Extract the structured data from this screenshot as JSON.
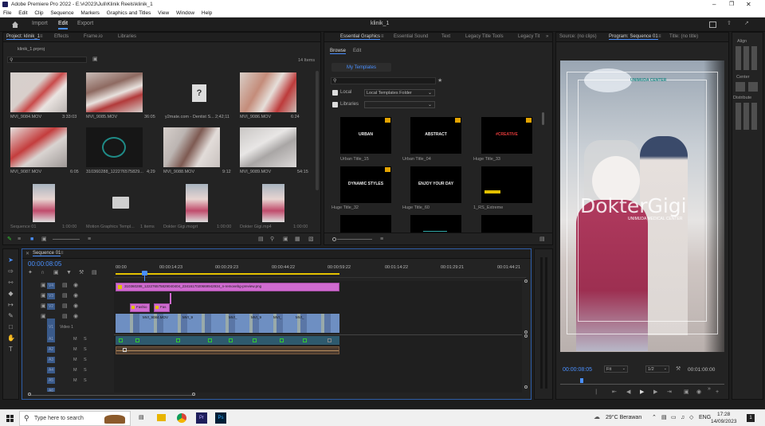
{
  "window": {
    "title": "Adobe Premiere Pro 2022 - E:\\#2023\\Juli\\Klinik Reels\\klinik_1"
  },
  "menu": [
    "File",
    "Edit",
    "Clip",
    "Sequence",
    "Markers",
    "Graphics and Titles",
    "View",
    "Window",
    "Help"
  ],
  "workspace": {
    "home": "home-icon",
    "tabs": [
      "Import",
      "Edit",
      "Export"
    ],
    "active": "Edit",
    "doc_title": "klinik_1"
  },
  "project": {
    "tabs": [
      "Project: klinik_1",
      "Effects",
      "Frame.io",
      "Libraries"
    ],
    "file": "klinik_1.prproj",
    "item_count": "14 Items",
    "items": [
      {
        "name": "MVI_9084.MOV",
        "dur": "3:33:03"
      },
      {
        "name": "MVI_9085.MOV",
        "dur": "36:05"
      },
      {
        "name": "y2mate.com - Dentist S...",
        "dur": "2;42;11"
      },
      {
        "name": "MVI_9086.MOV",
        "dur": "6:24"
      },
      {
        "name": "MVI_9087.MOV",
        "dur": "6:05"
      },
      {
        "name": "310360288_122276575829...",
        "dur": "4;29"
      },
      {
        "name": "MVI_9088.MOV",
        "dur": "9:12"
      },
      {
        "name": "MVI_9089.MOV",
        "dur": "54:15"
      },
      {
        "name": "Sequence 01",
        "dur": "1:00:00"
      },
      {
        "name": "Motion Graphics Templ...",
        "dur": "1 items"
      },
      {
        "name": "Dokter Gigi.mogrt",
        "dur": "1:00:00"
      },
      {
        "name": "Dokter Gigi.mp4",
        "dur": "1:00:00"
      }
    ]
  },
  "essential": {
    "tabs": [
      "Essential Graphics",
      "Essential Sound",
      "Text",
      "Legacy Title Tools",
      "Legacy Tit"
    ],
    "subtabs": [
      "Browse",
      "Edit"
    ],
    "my_templates": "My Templates",
    "local_label": "Local",
    "local_value": "Local Templates Folder",
    "libraries_label": "Libraries",
    "templates": [
      {
        "name": "Urban Title_15",
        "art": "URBAN"
      },
      {
        "name": "Urban Title_04",
        "art": "ABSTRACT"
      },
      {
        "name": "Huge Title_33",
        "art": "#CREATIVE"
      },
      {
        "name": "Huge Title_32",
        "art": "DYNAMIC STYLES"
      },
      {
        "name": "Huge Title_60",
        "art": "ENJOY YOUR DAY"
      },
      {
        "name": "1_RS_Extreme",
        "art": ""
      }
    ]
  },
  "monitor": {
    "tabs": [
      "Source: (no clips)",
      "Program: Sequence 01",
      "Title: (no title)"
    ],
    "timecode": "00:00:08:05",
    "fit": "Fit",
    "resolution": "1/2",
    "duration": "00:01:00:00",
    "overlay_title": "DokterGigi",
    "overlay_sub": "UNIMUDA MEDICAL CENTER",
    "logo": "UNIMUDA CENTER"
  },
  "align": {
    "title": "Align",
    "center": "Center",
    "distribute": "Distribute"
  },
  "timeline": {
    "tab": "Sequence 01",
    "timecode": "00:00:08:05",
    "ruler": [
      "00:00",
      "00:00:14:23",
      "00:00:29:23",
      "00:00:44:22",
      "00:00:59:22",
      "00:01:14:22",
      "00:01:29:21",
      "00:01:44:21"
    ],
    "tracks": [
      "V4",
      "V3",
      "V2",
      "V1",
      "A1",
      "A2",
      "A3",
      "A4",
      "A5",
      "A6"
    ],
    "video1_label": "Video 1",
    "v4_clip": "310360288_122276575829040404_2341617020669942934_n-removebg-preview.png",
    "v2_clips": [
      "Fashio",
      "Fas"
    ],
    "v1_clips": [
      "MVI_9084.MOV",
      "MVI_9",
      "MVI_",
      "MVI_9",
      "MVI_",
      "MVI_"
    ],
    "track_buttons": {
      "mute": "M",
      "solo": "S"
    }
  },
  "taskbar": {
    "search_placeholder": "Type here to search",
    "weather": "29°C Berawan",
    "lang": "ENG",
    "time": "17:28",
    "date": "14/09/2023"
  }
}
